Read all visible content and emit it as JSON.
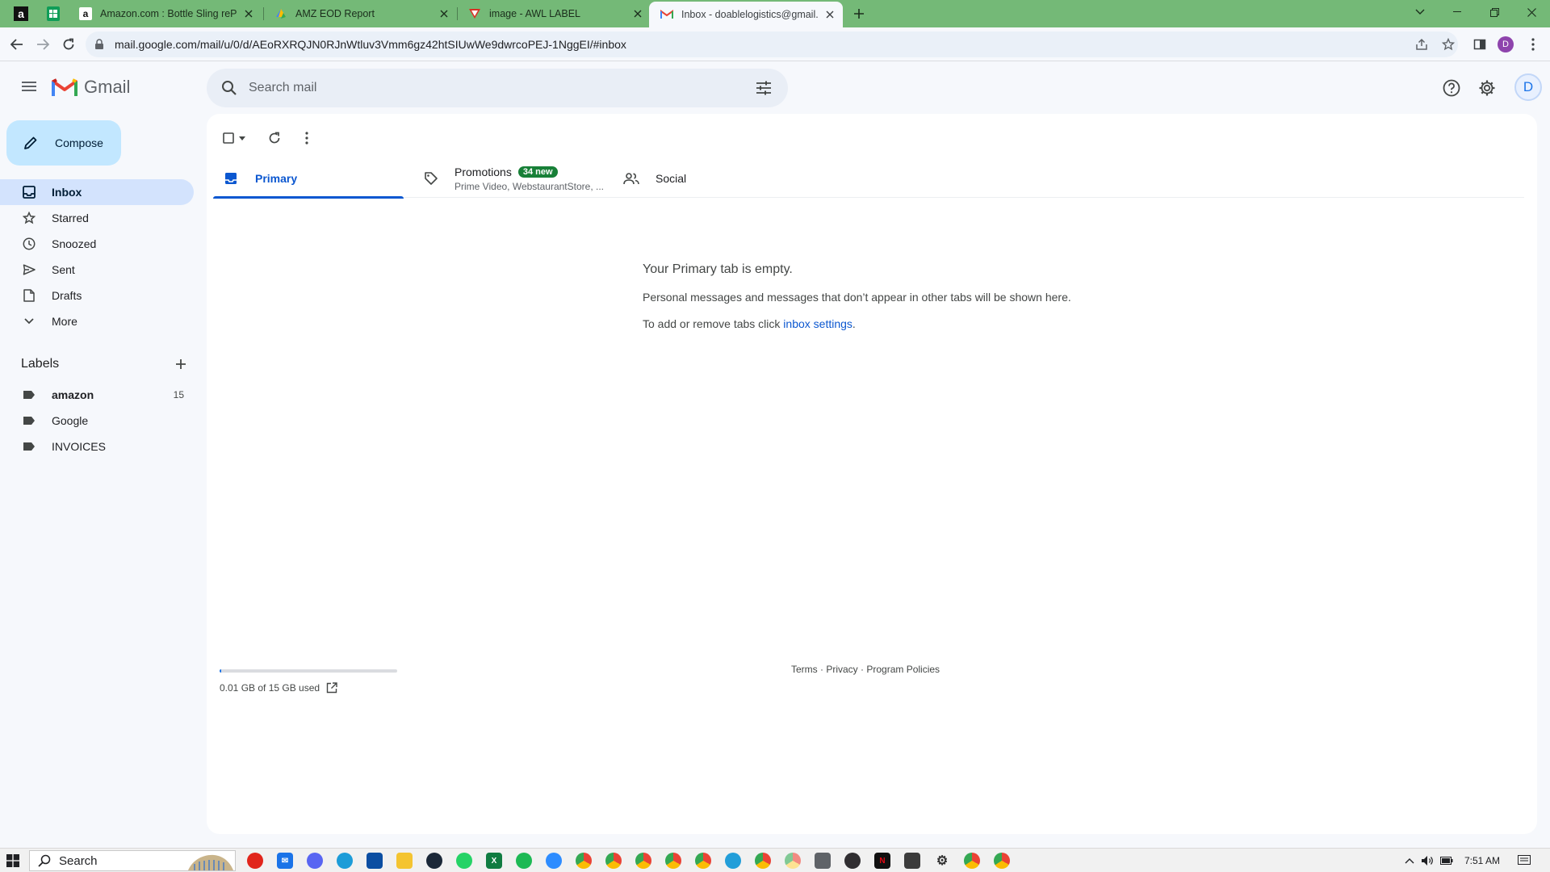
{
  "browser": {
    "tabs": [
      {
        "title": "Amazon.com : Bottle Sling rePET",
        "favicon": "amazon-icon",
        "active": false
      },
      {
        "title": "AMZ EOD Report",
        "favicon": "sheets-icon",
        "active": false
      },
      {
        "title": "image - AWL LABEL",
        "favicon": "vercel-icon",
        "active": false
      },
      {
        "title": "Inbox - doablelogistics@gmail.com",
        "favicon": "gmail-icon",
        "active": true
      }
    ],
    "url": "mail.google.com/mail/u/0/d/AEoRXRQJN0RJnWtluv3Vmm6gz42htSIUwWe9dwrcoPEJ-1NggEI/#inbox",
    "profile_initial": "D",
    "frame_color": "#74b977"
  },
  "gmail": {
    "logo_text": "Gmail",
    "search_placeholder": "Search mail",
    "account_initial": "D",
    "compose_label": "Compose",
    "nav": [
      {
        "label": "Inbox",
        "icon": "inbox-icon",
        "active": true
      },
      {
        "label": "Starred",
        "icon": "star-icon",
        "active": false
      },
      {
        "label": "Snoozed",
        "icon": "clock-icon",
        "active": false
      },
      {
        "label": "Sent",
        "icon": "send-icon",
        "active": false
      },
      {
        "label": "Drafts",
        "icon": "draft-icon",
        "active": false
      },
      {
        "label": "More",
        "icon": "chevron-down-icon",
        "active": false
      }
    ],
    "labels_heading": "Labels",
    "labels": [
      {
        "name": "amazon",
        "count": "15",
        "bold": true
      },
      {
        "name": "Google",
        "count": "",
        "bold": false
      },
      {
        "name": "INVOICES",
        "count": "",
        "bold": false
      }
    ],
    "tabs": {
      "primary": {
        "label": "Primary"
      },
      "promotions": {
        "label": "Promotions",
        "badge": "34 new",
        "subtitle": "Prime Video, WebstaurantStore, ..."
      },
      "social": {
        "label": "Social"
      }
    },
    "empty_state": {
      "heading": "Your Primary tab is empty.",
      "line1": "Personal messages and messages that don’t appear in other tabs will be shown here.",
      "line2_prefix": "To add or remove tabs click ",
      "line2_link": "inbox settings",
      "line2_suffix": "."
    },
    "storage": {
      "text": "0.01 GB of 15 GB used",
      "used_fraction": 0.001
    },
    "footer": {
      "terms": "Terms",
      "sep": " · ",
      "privacy": "Privacy",
      "policies": "Program Policies"
    }
  },
  "taskbar": {
    "search_label": "Search",
    "time": "7:51 AM",
    "apps": [
      "roblox-icon",
      "mail-icon",
      "discord-icon",
      "edge-icon",
      "store-icon",
      "files-icon",
      "steam-icon",
      "whatsapp-icon",
      "excel-icon",
      "spotify-icon",
      "zoom-icon",
      "chrome-icon",
      "chrome-icon",
      "chrome-icon",
      "chrome-icon",
      "chrome-icon",
      "telegram-icon",
      "chrome-icon",
      "chrome-icon",
      "calculator-icon",
      "obs-icon",
      "netflix-icon",
      "media-icon",
      "settings-icon",
      "chrome-icon",
      "chrome-icon"
    ]
  }
}
